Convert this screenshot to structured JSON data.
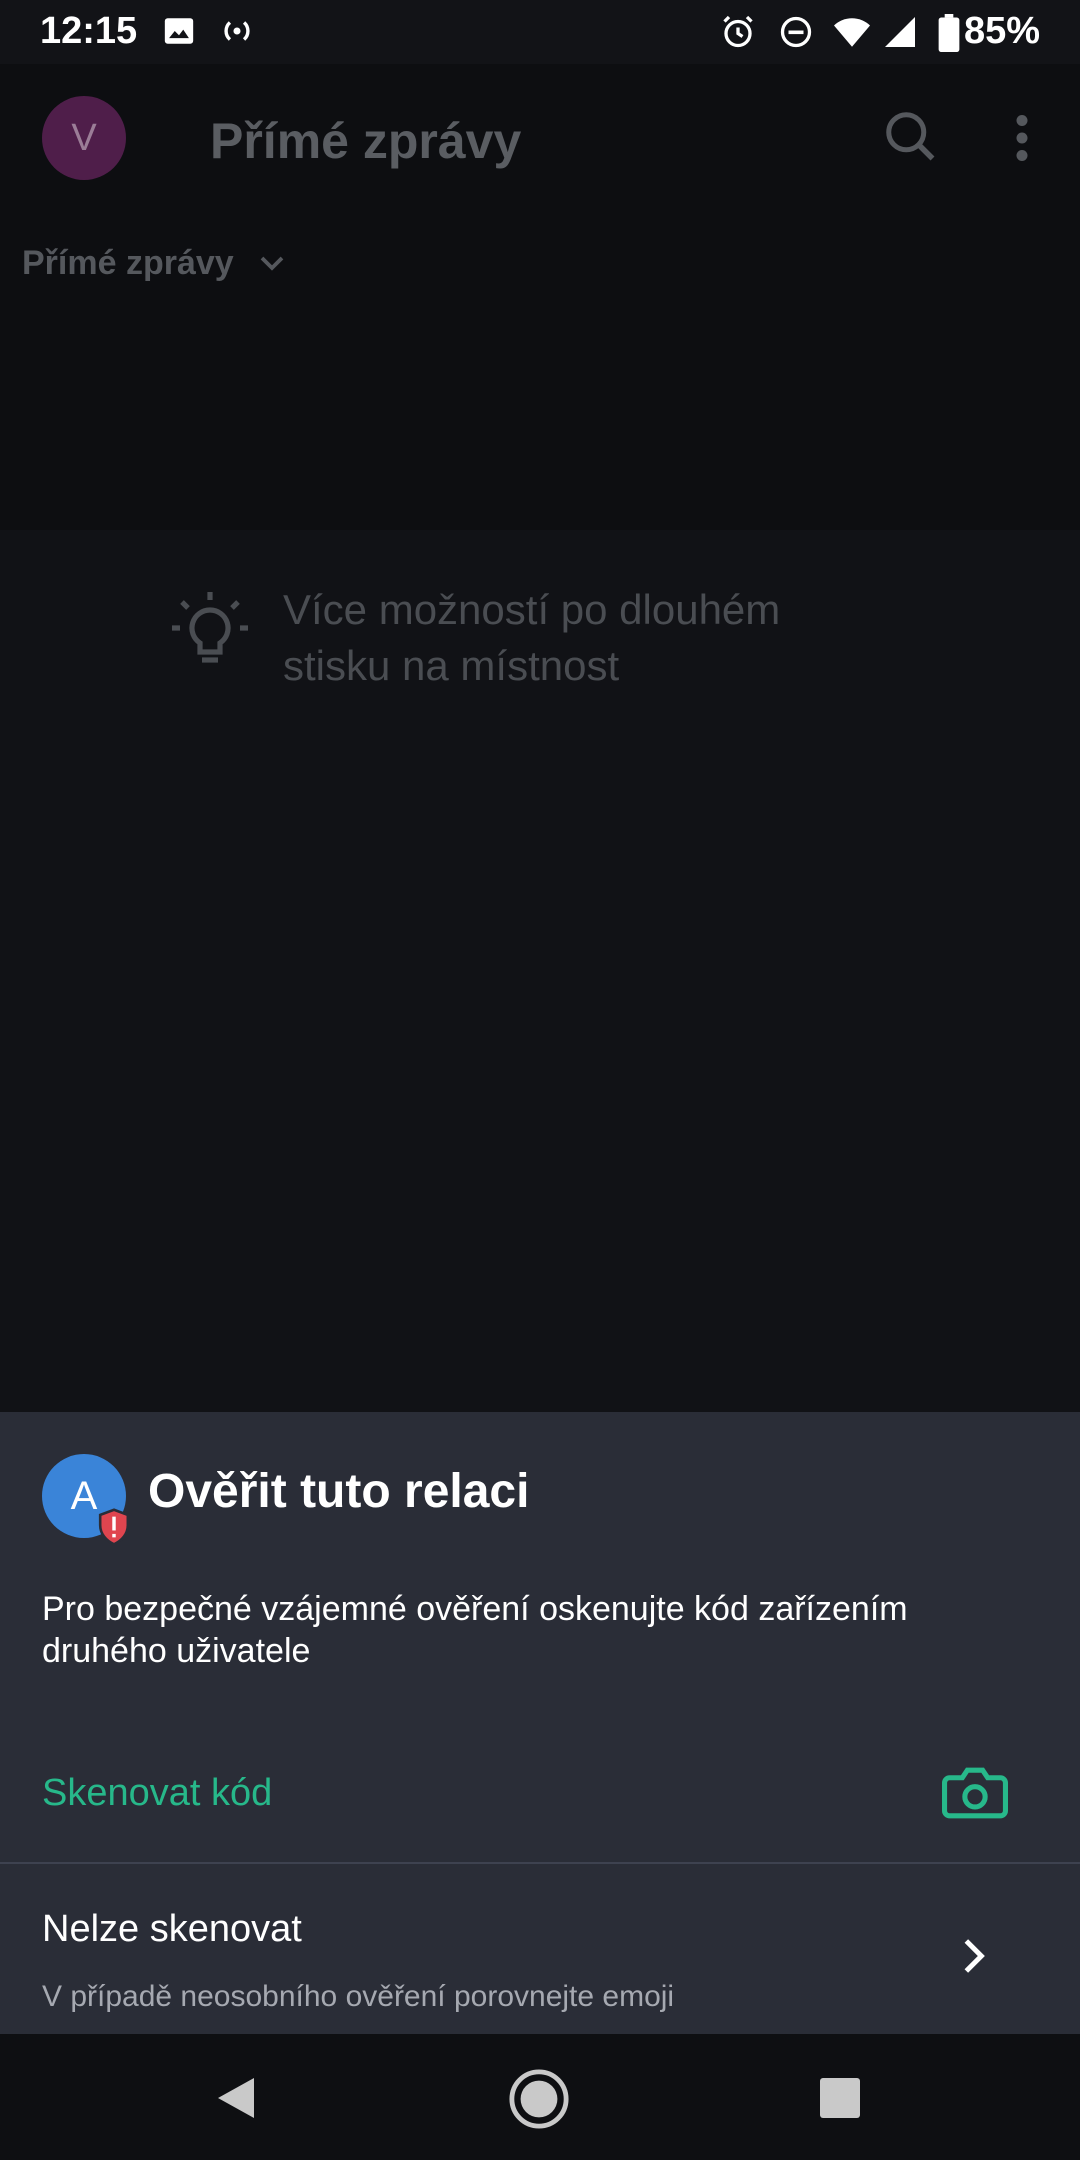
{
  "status_bar": {
    "time": "12:15",
    "battery": "85%",
    "icons": [
      "image-icon",
      "broadcast-icon",
      "alarm-icon",
      "dnd-icon",
      "wifi-icon",
      "signal-icon",
      "battery-icon"
    ]
  },
  "app_bar": {
    "avatar_letter": "V",
    "title": "Přímé zprávy",
    "icons": [
      "search-icon",
      "more-vert-icon"
    ]
  },
  "filter": {
    "label": "Přímé zprávy",
    "icon": "chevron-down-icon"
  },
  "hint": {
    "icon": "lightbulb-icon",
    "text_line1": "Více možností po dlouhém",
    "text_line2": "stisku na místnost"
  },
  "sheet": {
    "avatar_letter": "A",
    "badge_icon": "shield-warning-icon",
    "title": "Ověřit tuto relaci",
    "description": "Pro bezpečné vzájemné ověření oskenujte kód zařízením druhého uživatele",
    "scan_label": "Skenovat kód",
    "scan_icon": "camera-icon",
    "cant_title": "Nelze skenovat",
    "cant_subtitle": "V případě neosobního ověření porovnejte emoji",
    "cant_icon": "chevron-right-icon"
  },
  "colors": {
    "accent": "#27b88a",
    "sheet_bg": "#2a2d37",
    "app_bg": "#121317",
    "avatar_a": "#3a84d8",
    "avatar_v": "#4f1e4a",
    "warning": "#e0454f"
  },
  "nav_bar": {
    "icons": [
      "back-icon",
      "home-icon",
      "recents-icon"
    ]
  }
}
